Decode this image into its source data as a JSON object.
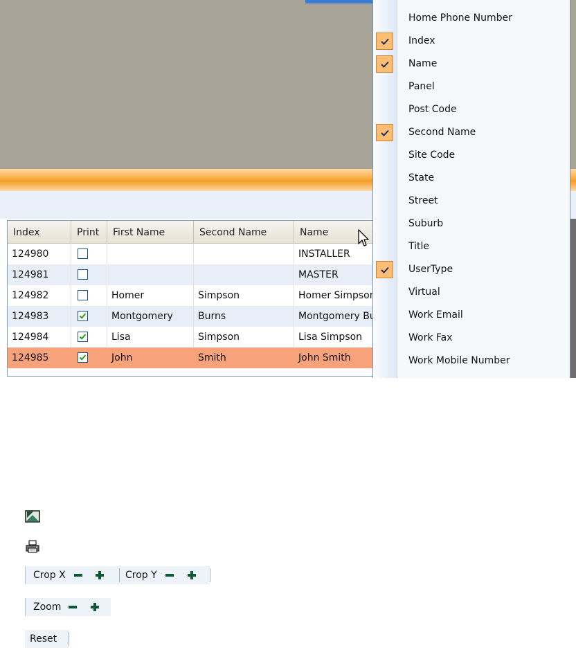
{
  "grid": {
    "columns": [
      "Index",
      "Print",
      "First Name",
      "Second Name",
      "Name"
    ],
    "rows": [
      {
        "index": "124980",
        "print": false,
        "first": "",
        "second": "",
        "name": "INSTALLER",
        "selected": false
      },
      {
        "index": "124981",
        "print": false,
        "first": "",
        "second": "",
        "name": "MASTER",
        "selected": false
      },
      {
        "index": "124982",
        "print": false,
        "first": "Homer",
        "second": "Simpson",
        "name": "Homer Simpson",
        "selected": false
      },
      {
        "index": "124983",
        "print": true,
        "first": "Montgomery",
        "second": "Burns",
        "name": "Montgomery Burns",
        "selected": false
      },
      {
        "index": "124984",
        "print": true,
        "first": "Lisa",
        "second": "Simpson",
        "name": "Lisa Simpson",
        "selected": false
      },
      {
        "index": "124985",
        "print": true,
        "first": "John",
        "second": "Smith",
        "name": "John Smith",
        "selected": true
      }
    ]
  },
  "column_menu": {
    "items": [
      {
        "label": "Home Phone Number",
        "checked": false
      },
      {
        "label": "Index",
        "checked": true
      },
      {
        "label": "Name",
        "checked": true
      },
      {
        "label": "Panel",
        "checked": false
      },
      {
        "label": "Post Code",
        "checked": false
      },
      {
        "label": "Second Name",
        "checked": true
      },
      {
        "label": "Site Code",
        "checked": false
      },
      {
        "label": "State",
        "checked": false
      },
      {
        "label": "Street",
        "checked": false
      },
      {
        "label": "Suburb",
        "checked": false
      },
      {
        "label": "Title",
        "checked": false
      },
      {
        "label": "UserType",
        "checked": true
      },
      {
        "label": "Virtual",
        "checked": false
      },
      {
        "label": "Work Email",
        "checked": false
      },
      {
        "label": "Work Fax",
        "checked": false
      },
      {
        "label": "Work Mobile Number",
        "checked": false
      }
    ]
  },
  "toolbar": {
    "crop_x_label": "Crop X",
    "crop_y_label": "Crop Y",
    "zoom_label": "Zoom",
    "reset_label": "Reset"
  },
  "icons": {
    "image_icon": "image-icon",
    "print_icon": "printer-icon",
    "minus_icon": "minus-icon",
    "plus_icon": "plus-icon"
  },
  "colors": {
    "selected_row": "#f7a27a",
    "menu_check": "#fdbd72",
    "orange_band": "#f39d28",
    "gray_background": "#a8a497"
  }
}
